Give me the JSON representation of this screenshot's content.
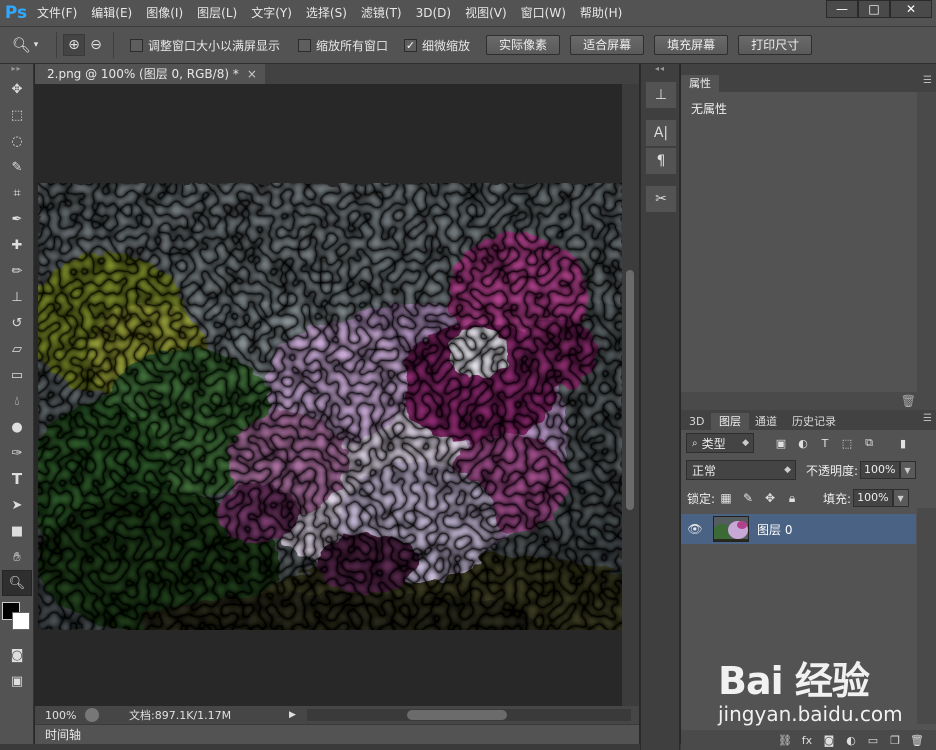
{
  "app": {
    "logo": "Ps"
  },
  "menu": [
    "文件(F)",
    "编辑(E)",
    "图像(I)",
    "图层(L)",
    "文字(Y)",
    "选择(S)",
    "滤镜(T)",
    "3D(D)",
    "视图(V)",
    "窗口(W)",
    "帮助(H)"
  ],
  "window_controls": {
    "minimize": "—",
    "maximize": "□",
    "close": "✕"
  },
  "options_bar": {
    "resize_windows_label": "调整窗口大小以满屏显示",
    "resize_windows_checked": false,
    "zoom_all_label": "缩放所有窗口",
    "zoom_all_checked": false,
    "scrubby_zoom_label": "细微缩放",
    "scrubby_zoom_checked": true,
    "actual_pixels": "实际像素",
    "fit_screen": "适合屏幕",
    "fill_screen": "填充屏幕",
    "print_size": "打印尺寸"
  },
  "document": {
    "tab_title": "2.png @ 100% (图层 0, RGB/8) *",
    "close": "×"
  },
  "status": {
    "zoom": "100%",
    "doc_info": "文档:897.1K/1.17M"
  },
  "timeline_label": "时间轴",
  "properties_panel": {
    "tab": "属性",
    "content": "无属性"
  },
  "layers_panel": {
    "tabs": [
      "3D",
      "图层",
      "通道",
      "历史记录"
    ],
    "active_tab": "图层",
    "filter_kind": "类型",
    "blend_mode": "正常",
    "opacity_label": "不透明度:",
    "opacity_value": "100%",
    "lock_label": "锁定:",
    "fill_label": "填充:",
    "fill_value": "100%",
    "layers": [
      {
        "name": "图层 0",
        "visible": true,
        "selected": true
      }
    ]
  },
  "watermark": {
    "brand": "Bai 经验",
    "url": "jingyan.baidu.com"
  },
  "colors": {
    "foreground": "#000000",
    "background": "#ffffff",
    "layer_selected": "#4a6284",
    "ps_blue": "#31a8ff"
  }
}
